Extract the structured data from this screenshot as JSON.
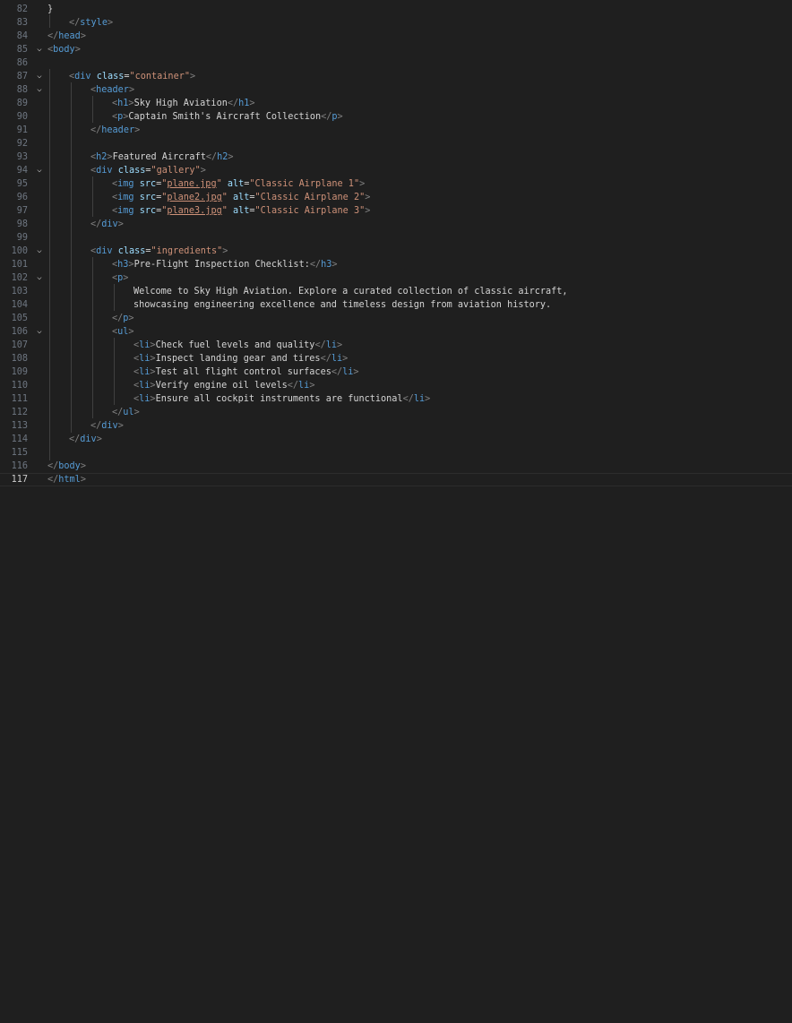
{
  "editor": {
    "lines": [
      {
        "n": "82",
        "text": "}"
      },
      {
        "n": "83",
        "text": "</style>"
      },
      {
        "n": "84",
        "text": "</head>"
      },
      {
        "n": "85",
        "text": "<body>"
      },
      {
        "n": "86",
        "text": ""
      },
      {
        "n": "87",
        "text": "<div class=\"container\">"
      },
      {
        "n": "88",
        "text": "<header>"
      },
      {
        "n": "89",
        "text": "<h1>Sky High Aviation</h1>"
      },
      {
        "n": "90",
        "text": "<p>Captain Smith's Aircraft Collection</p>"
      },
      {
        "n": "91",
        "text": "</header>"
      },
      {
        "n": "92",
        "text": ""
      },
      {
        "n": "93",
        "text": "<h2>Featured Aircraft</h2>"
      },
      {
        "n": "94",
        "text": "<div class=\"gallery\">"
      },
      {
        "n": "95",
        "text": "<img src=\"plane.jpg\" alt=\"Classic Airplane 1\">"
      },
      {
        "n": "96",
        "text": "<img src=\"plane2.jpg\" alt=\"Classic Airplane 2\">"
      },
      {
        "n": "97",
        "text": "<img src=\"plane3.jpg\" alt=\"Classic Airplane 3\">"
      },
      {
        "n": "98",
        "text": "</div>"
      },
      {
        "n": "99",
        "text": ""
      },
      {
        "n": "100",
        "text": "<div class=\"ingredients\">"
      },
      {
        "n": "101",
        "text": "<h3>Pre-Flight Inspection Checklist:</h3>"
      },
      {
        "n": "102",
        "text": "<p>"
      },
      {
        "n": "103",
        "text": "Welcome to Sky High Aviation. Explore a curated collection of classic aircraft,"
      },
      {
        "n": "104",
        "text": "showcasing engineering excellence and timeless design from aviation history."
      },
      {
        "n": "105",
        "text": "</p>"
      },
      {
        "n": "106",
        "text": "<ul>"
      },
      {
        "n": "107",
        "text": "<li>Check fuel levels and quality</li>"
      },
      {
        "n": "108",
        "text": "<li>Inspect landing gear and tires</li>"
      },
      {
        "n": "109",
        "text": "<li>Test all flight control surfaces</li>"
      },
      {
        "n": "110",
        "text": "<li>Verify engine oil levels</li>"
      },
      {
        "n": "111",
        "text": "<li>Ensure all cockpit instruments are functional</li>"
      },
      {
        "n": "112",
        "text": "</ul>"
      },
      {
        "n": "113",
        "text": "</div>"
      },
      {
        "n": "114",
        "text": "</div>"
      },
      {
        "n": "115",
        "text": ""
      },
      {
        "n": "116",
        "text": "</body>"
      },
      {
        "n": "117",
        "text": "</html>"
      }
    ],
    "current_line": "117",
    "colors": {
      "background": "#1f1f1f",
      "line_number": "#6e7681",
      "tag": "#569cd6",
      "attribute": "#9cdcfe",
      "string": "#ce9178",
      "text": "#d4d4d4",
      "bracket": "#808080"
    }
  }
}
